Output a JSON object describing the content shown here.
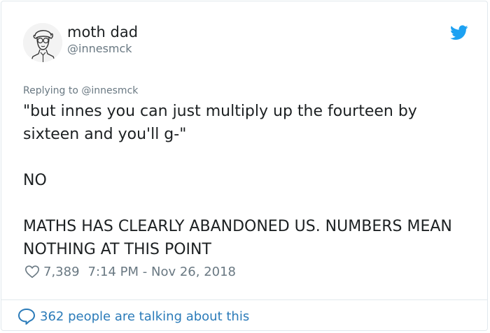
{
  "author": {
    "display_name": "moth dad",
    "handle": "@innesmck"
  },
  "reply_context": {
    "prefix": "Replying to",
    "mention": "@innesmck"
  },
  "tweet": {
    "lines": [
      "\"but innes you can just multiply up the fourteen by sixteen and you'll g-\"",
      "NO",
      "MATHS HAS CLEARLY ABANDONED US. NUMBERS MEAN NOTHING AT THIS POINT"
    ]
  },
  "meta": {
    "like_count": "7,389",
    "timestamp": "7:14 PM - Nov 26, 2018"
  },
  "footer": {
    "label": "362 people are talking about this"
  },
  "icons": {
    "logo": "twitter-bird-icon",
    "like": "heart-icon",
    "conversation": "speech-bubble-icon"
  },
  "colors": {
    "brand": "#1da1f2",
    "link": "#2b7bb9",
    "text": "#1c2022",
    "muted": "#697882",
    "border": "#e1e8ed"
  }
}
